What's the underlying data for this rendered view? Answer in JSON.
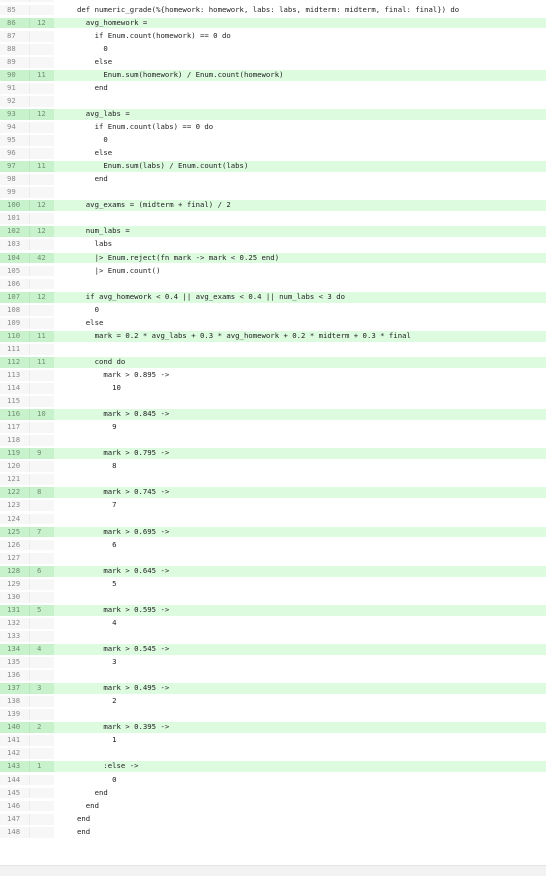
{
  "lines": [
    {
      "n": "84",
      "hits": "",
      "code": ""
    },
    {
      "n": "85",
      "hits": "",
      "code": "def numeric_grade(%{homework: homework, labs: labs, midterm: midterm, final: final}) do"
    },
    {
      "n": "86",
      "hits": "12",
      "code": "  avg_homework ="
    },
    {
      "n": "87",
      "hits": "",
      "code": "    if Enum.count(homework) == 0 do"
    },
    {
      "n": "88",
      "hits": "",
      "code": "      0"
    },
    {
      "n": "89",
      "hits": "",
      "code": "    else"
    },
    {
      "n": "90",
      "hits": "11",
      "code": "      Enum.sum(homework) / Enum.count(homework)"
    },
    {
      "n": "91",
      "hits": "",
      "code": "    end"
    },
    {
      "n": "92",
      "hits": "",
      "code": ""
    },
    {
      "n": "93",
      "hits": "12",
      "code": "  avg_labs ="
    },
    {
      "n": "94",
      "hits": "",
      "code": "    if Enum.count(labs) == 0 do"
    },
    {
      "n": "95",
      "hits": "",
      "code": "      0"
    },
    {
      "n": "96",
      "hits": "",
      "code": "    else"
    },
    {
      "n": "97",
      "hits": "11",
      "code": "      Enum.sum(labs) / Enum.count(labs)"
    },
    {
      "n": "98",
      "hits": "",
      "code": "    end"
    },
    {
      "n": "99",
      "hits": "",
      "code": ""
    },
    {
      "n": "100",
      "hits": "12",
      "code": "  avg_exams = (midterm + final) / 2"
    },
    {
      "n": "101",
      "hits": "",
      "code": ""
    },
    {
      "n": "102",
      "hits": "12",
      "code": "  num_labs ="
    },
    {
      "n": "103",
      "hits": "",
      "code": "    labs"
    },
    {
      "n": "104",
      "hits": "42",
      "code": "    |> Enum.reject(fn mark -> mark < 0.25 end)"
    },
    {
      "n": "105",
      "hits": "",
      "code": "    |> Enum.count()"
    },
    {
      "n": "106",
      "hits": "",
      "code": ""
    },
    {
      "n": "107",
      "hits": "12",
      "code": "  if avg_homework < 0.4 || avg_exams < 0.4 || num_labs < 3 do"
    },
    {
      "n": "108",
      "hits": "",
      "code": "    0"
    },
    {
      "n": "109",
      "hits": "",
      "code": "  else"
    },
    {
      "n": "110",
      "hits": "11",
      "code": "    mark = 0.2 * avg_labs + 0.3 * avg_homework + 0.2 * midterm + 0.3 * final"
    },
    {
      "n": "111",
      "hits": "",
      "code": ""
    },
    {
      "n": "112",
      "hits": "11",
      "code": "    cond do"
    },
    {
      "n": "113",
      "hits": "",
      "code": "      mark > 0.895 ->"
    },
    {
      "n": "114",
      "hits": "",
      "code": "        10"
    },
    {
      "n": "115",
      "hits": "",
      "code": ""
    },
    {
      "n": "116",
      "hits": "10",
      "code": "      mark > 0.845 ->"
    },
    {
      "n": "117",
      "hits": "",
      "code": "        9"
    },
    {
      "n": "118",
      "hits": "",
      "code": ""
    },
    {
      "n": "119",
      "hits": "9",
      "code": "      mark > 0.795 ->"
    },
    {
      "n": "120",
      "hits": "",
      "code": "        8"
    },
    {
      "n": "121",
      "hits": "",
      "code": ""
    },
    {
      "n": "122",
      "hits": "8",
      "code": "      mark > 0.745 ->"
    },
    {
      "n": "123",
      "hits": "",
      "code": "        7"
    },
    {
      "n": "124",
      "hits": "",
      "code": ""
    },
    {
      "n": "125",
      "hits": "7",
      "code": "      mark > 0.695 ->"
    },
    {
      "n": "126",
      "hits": "",
      "code": "        6"
    },
    {
      "n": "127",
      "hits": "",
      "code": ""
    },
    {
      "n": "128",
      "hits": "6",
      "code": "      mark > 0.645 ->"
    },
    {
      "n": "129",
      "hits": "",
      "code": "        5"
    },
    {
      "n": "130",
      "hits": "",
      "code": ""
    },
    {
      "n": "131",
      "hits": "5",
      "code": "      mark > 0.595 ->"
    },
    {
      "n": "132",
      "hits": "",
      "code": "        4"
    },
    {
      "n": "133",
      "hits": "",
      "code": ""
    },
    {
      "n": "134",
      "hits": "4",
      "code": "      mark > 0.545 ->"
    },
    {
      "n": "135",
      "hits": "",
      "code": "        3"
    },
    {
      "n": "136",
      "hits": "",
      "code": ""
    },
    {
      "n": "137",
      "hits": "3",
      "code": "      mark > 0.495 ->"
    },
    {
      "n": "138",
      "hits": "",
      "code": "        2"
    },
    {
      "n": "139",
      "hits": "",
      "code": ""
    },
    {
      "n": "140",
      "hits": "2",
      "code": "      mark > 0.395 ->"
    },
    {
      "n": "141",
      "hits": "",
      "code": "        1"
    },
    {
      "n": "142",
      "hits": "",
      "code": ""
    },
    {
      "n": "143",
      "hits": "1",
      "code": "      :else ->"
    },
    {
      "n": "144",
      "hits": "",
      "code": "        0"
    },
    {
      "n": "145",
      "hits": "",
      "code": "    end"
    },
    {
      "n": "146",
      "hits": "",
      "code": "  end"
    },
    {
      "n": "147",
      "hits": "",
      "code": "end"
    },
    {
      "n": "148",
      "hits": "",
      "code": "end"
    }
  ],
  "colors": {
    "covered_row": "#dcfbdf",
    "covered_gutter": "#c8f2cc",
    "gutter": "#f7f7f7",
    "text": "#222222",
    "muted": "#8a8a8a"
  }
}
